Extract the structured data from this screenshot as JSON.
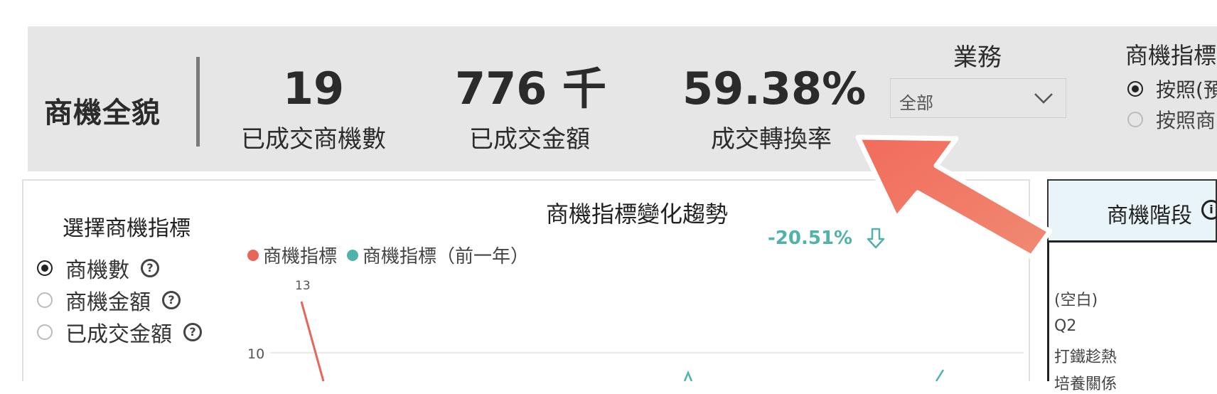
{
  "kpi": {
    "title": "商機全貌",
    "items": [
      {
        "value": "19",
        "label": "已成交商機數"
      },
      {
        "value": "776 千",
        "label": "已成交金額"
      },
      {
        "value": "59.38%",
        "label": "成交轉換率"
      }
    ]
  },
  "filter": {
    "title": "業務",
    "selected": "全部"
  },
  "metric_basis": {
    "title": "商機指標",
    "options": [
      {
        "label": "按照(預",
        "selected": true
      },
      {
        "label": "按照商",
        "selected": false
      }
    ]
  },
  "selector": {
    "title": "選擇商機指標",
    "help_glyph": "?",
    "options": [
      {
        "label": "商機數",
        "selected": true
      },
      {
        "label": "商機金額",
        "selected": false
      },
      {
        "label": "已成交金額",
        "selected": false
      }
    ]
  },
  "trend": {
    "title": "商機指標變化趨勢",
    "change": "-20.51%",
    "change_direction": "down"
  },
  "chart_data": {
    "type": "line",
    "series": [
      {
        "name": "商機指標",
        "color": "#e8655a"
      },
      {
        "name": "商機指標（前一年）",
        "color": "#4fb3a9"
      }
    ],
    "y_ticks": [
      "10"
    ],
    "data_labels": [
      "13"
    ],
    "peak_value": 13
  },
  "stage_panel": {
    "title": "商機階段",
    "info_glyph": "i",
    "items": [
      "(空白)",
      "Q2",
      "打鐵趁熱",
      "培養關係"
    ]
  },
  "colors": {
    "accent_red": "#e8655a",
    "accent_teal": "#4fb3a9",
    "kpi_bg": "#e6e6e6",
    "stage_header_bg": "#e8f4f8"
  }
}
